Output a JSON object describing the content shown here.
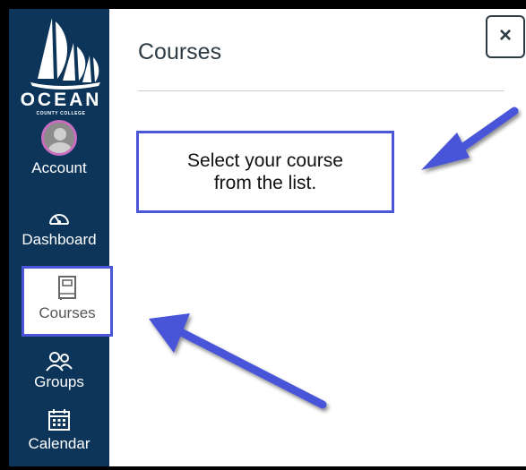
{
  "logo": {
    "name": "OCEAN",
    "subtitle": "COUNTY COLLEGE"
  },
  "nav": {
    "account": "Account",
    "dashboard": "Dashboard",
    "courses": "Courses",
    "groups": "Groups",
    "calendar": "Calendar"
  },
  "main": {
    "title": "Courses",
    "close_label": "×"
  },
  "callout": {
    "line1": "Select your course",
    "line2": "from the list."
  },
  "colors": {
    "sidebar": "#0c3559",
    "highlight": "#4a55d8",
    "avatar_ring": "#c86ec0"
  },
  "icons": [
    "user-avatar-icon",
    "speedometer-icon",
    "book-icon",
    "people-icon",
    "calendar-icon",
    "close-icon",
    "arrow-icon"
  ]
}
